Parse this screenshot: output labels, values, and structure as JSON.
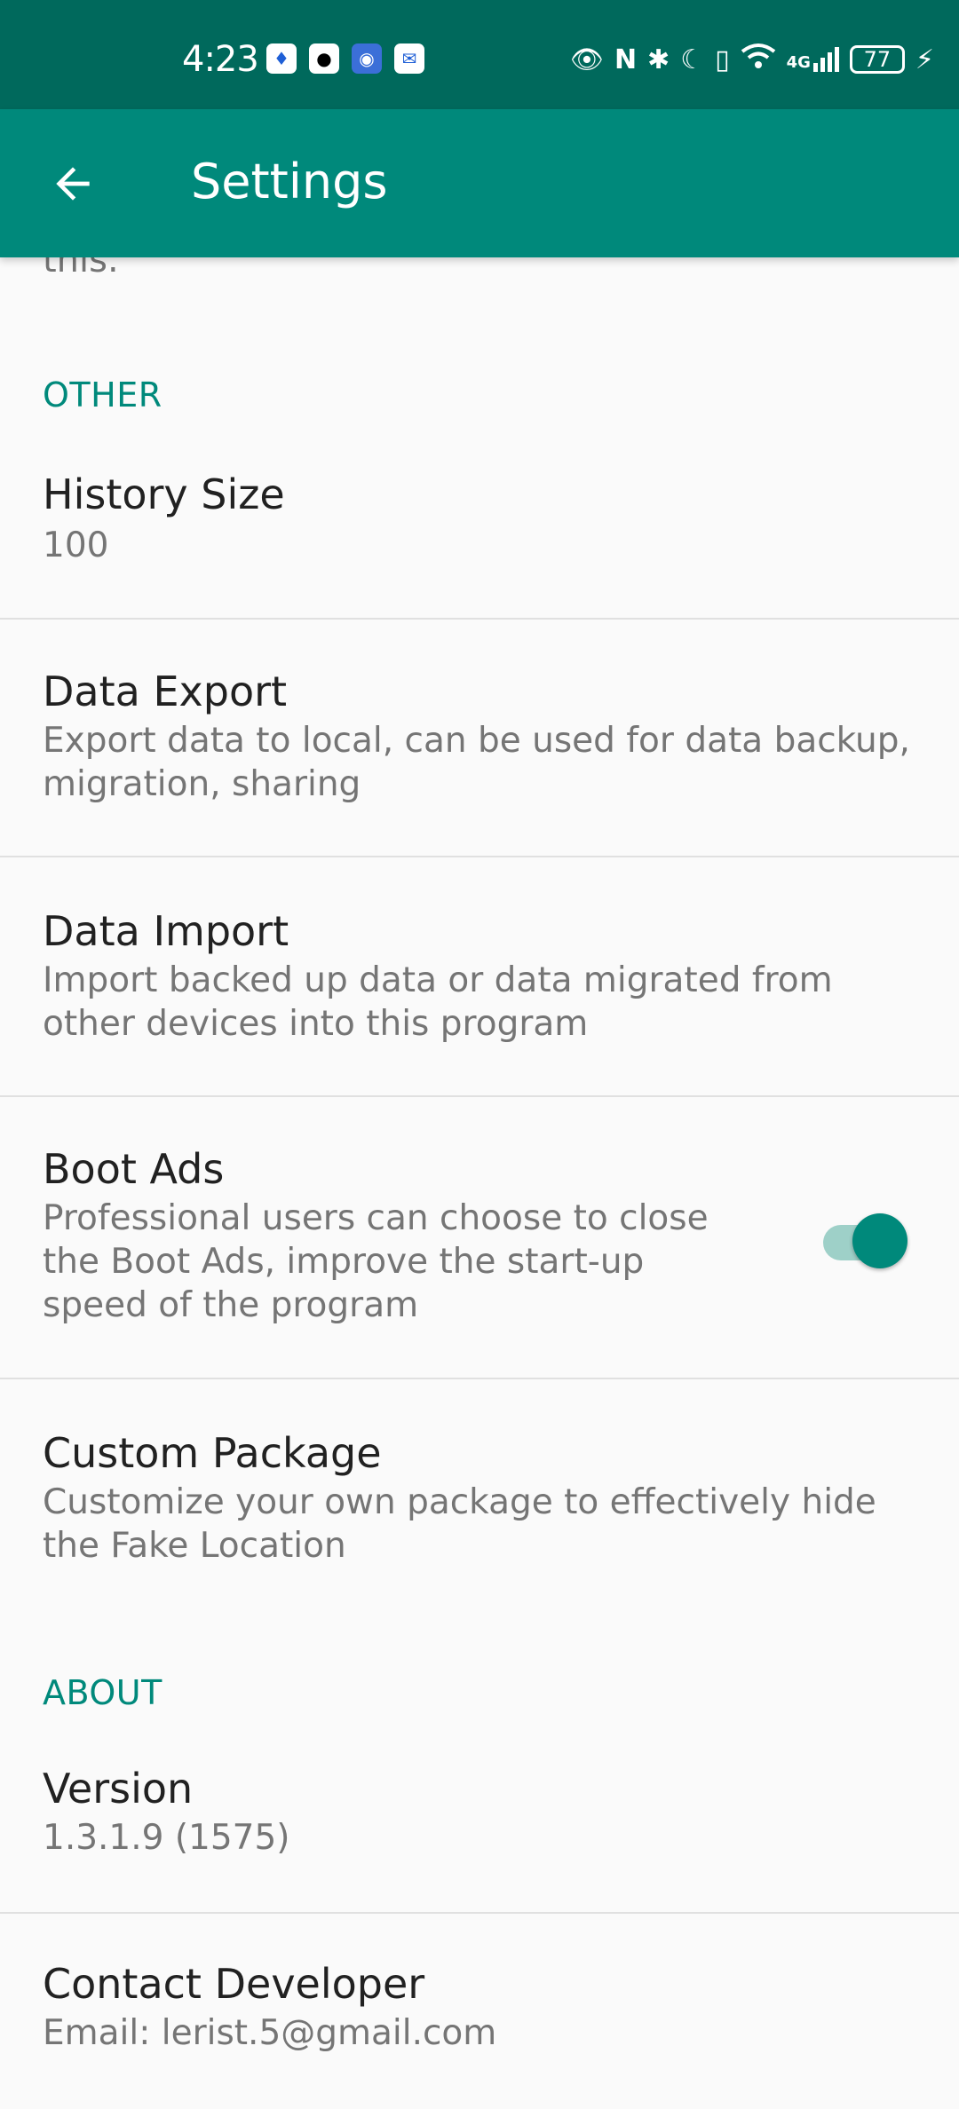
{
  "status_bar": {
    "time": "4:23",
    "notification_icons": [
      "shield-app-icon",
      "qq-icon",
      "browser-icon",
      "mail-icon"
    ],
    "right_icons": [
      "eye-icon",
      "nfc-icon",
      "bluetooth-icon",
      "moon-icon",
      "vibrate-icon",
      "wifi-icon",
      "signal-4g-icon"
    ],
    "network": "4G",
    "battery": "77"
  },
  "appbar": {
    "title": "Settings"
  },
  "cut_text": "this.",
  "sections": {
    "other": "OTHER",
    "about": "ABOUT"
  },
  "items": {
    "history_size": {
      "title": "History Size",
      "summary": "100"
    },
    "data_export": {
      "title": "Data Export",
      "summary": "Export data to local, can be used for data backup, migration, sharing"
    },
    "data_import": {
      "title": "Data Import",
      "summary": "Import backed up data or data migrated from other devices into this program"
    },
    "boot_ads": {
      "title": "Boot Ads",
      "summary": "Professional users can choose to close the Boot Ads, improve the start-up speed of the program",
      "enabled": true
    },
    "custom_package": {
      "title": "Custom Package",
      "summary": "Customize your own package to effectively hide the Fake Location"
    },
    "version": {
      "title": "Version",
      "summary": "1.3.1.9 (1575)"
    },
    "contact": {
      "title": "Contact Developer",
      "summary": "Email: lerist.5@gmail.com"
    }
  },
  "colors": {
    "accent": "#00897b",
    "statusbar": "#00695c",
    "background": "#fafafa"
  }
}
